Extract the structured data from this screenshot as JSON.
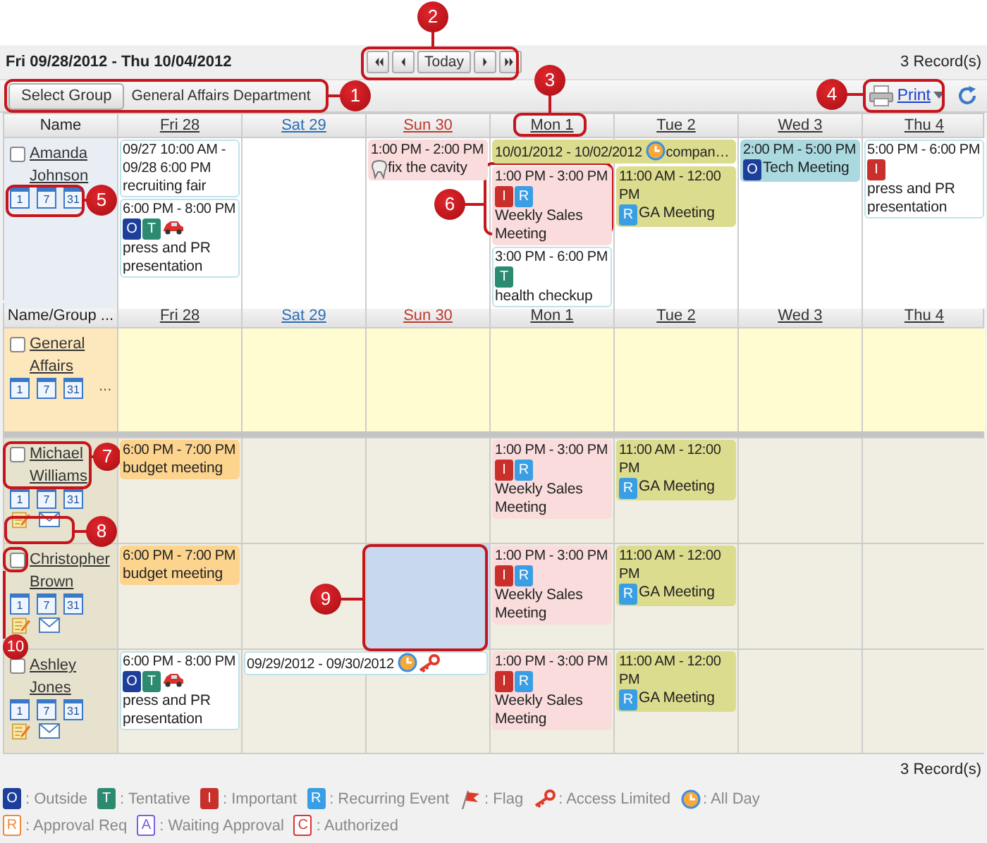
{
  "toolbar": {
    "date_range": "Fri 09/28/2012 - Thu 10/04/2012",
    "nav": [
      {
        "kind": "first"
      },
      {
        "kind": "prev"
      },
      {
        "kind": "today",
        "label": "Today"
      },
      {
        "kind": "next"
      },
      {
        "kind": "last"
      }
    ],
    "record_count": "3 Record(s)"
  },
  "group_bar": {
    "button": "Select Group",
    "group_name": "General Affairs Department",
    "print": "Print"
  },
  "top_section": {
    "header": {
      "name_label": "Name",
      "days": [
        {
          "label": "Fri 28",
          "kind": "weekday"
        },
        {
          "label": "Sat 29",
          "kind": "saturday"
        },
        {
          "label": "Sun 30",
          "kind": "sunday"
        },
        {
          "label": "Mon 1",
          "kind": "weekday"
        },
        {
          "label": "Tue 2",
          "kind": "weekday"
        },
        {
          "label": "Wed 3",
          "kind": "weekday"
        },
        {
          "label": "Thu 4",
          "kind": "weekday"
        }
      ]
    },
    "rows": [
      {
        "kind": "self",
        "name": "Amanda Johnson",
        "checked": false,
        "views": [
          "1",
          "7",
          "31"
        ],
        "tools": false,
        "days": [
          {
            "selected": false,
            "events": [
              {
                "kind": "plain",
                "time": "09/27 10:00 AM - 09/28 6:00 PM",
                "title": "recruiting fair",
                "color": "#ffffff"
              },
              {
                "kind": "vehicle",
                "time": "6:00 PM - 8:00 PM",
                "badges": [
                  {
                    "kind": "outside",
                    "letter": "O"
                  },
                  {
                    "kind": "tentative",
                    "letter": "T"
                  }
                ],
                "title": "press and PR presentation",
                "color": "#ffffff"
              }
            ]
          },
          {
            "selected": false
          },
          {
            "selected": false,
            "events": [
              {
                "kind": "dental",
                "time": "1:00 PM - 2:00 PM",
                "title": "fix the cavity",
                "color": "#fadcdc"
              }
            ]
          },
          {
            "selected": false,
            "events": [
              {
                "kind": "plain",
                "time": "10/01/2012 - 10/02/2012",
                "multi_day": true,
                "all_day": true,
                "title": "compan…",
                "color": "#dcdc8e"
              },
              {
                "kind": "plain",
                "time": "1:00 PM - 3:00 PM",
                "badges": [
                  {
                    "kind": "important",
                    "letter": "I"
                  },
                  {
                    "kind": "recurring",
                    "letter": "R"
                  }
                ],
                "title": "Weekly Sales Meeting",
                "color": "#fadcdc"
              },
              {
                "kind": "plain",
                "time": "3:00 PM - 6:00 PM",
                "badges": [
                  {
                    "kind": "tentative",
                    "letter": "T"
                  }
                ],
                "title": "health checkup",
                "color": "#ffffff"
              }
            ]
          },
          {
            "selected": false,
            "events": [
              {
                "kind": "plain",
                "time": "11:00 AM - 12:00 PM",
                "badges": [
                  {
                    "kind": "recurring",
                    "letter": "R"
                  }
                ],
                "title": "GA Meeting",
                "color": "#dcdc8e"
              }
            ]
          },
          {
            "selected": false,
            "events": [
              {
                "kind": "plain",
                "time": "2:00 PM - 5:00 PM",
                "badges": [
                  {
                    "kind": "outside",
                    "letter": "O"
                  }
                ],
                "title": "Tech Meeting",
                "color": "#aad9e0"
              }
            ]
          },
          {
            "selected": false,
            "events": [
              {
                "kind": "plain",
                "time": "5:00 PM - 6:00 PM",
                "badges": [
                  {
                    "kind": "important",
                    "letter": "I"
                  }
                ],
                "title": "press and PR presentation",
                "color": "#ffffff"
              }
            ]
          }
        ]
      }
    ]
  },
  "group_section": {
    "header": {
      "name_label": "Name/Group ...",
      "days": [
        {
          "label": "Fri 28",
          "kind": "weekday"
        },
        {
          "label": "Sat 29",
          "kind": "saturday"
        },
        {
          "label": "Sun 30",
          "kind": "sunday"
        },
        {
          "label": "Mon 1",
          "kind": "weekday"
        },
        {
          "label": "Tue 2",
          "kind": "weekday"
        },
        {
          "label": "Wed 3",
          "kind": "weekday"
        },
        {
          "label": "Thu 4",
          "kind": "weekday"
        }
      ]
    },
    "rows": [
      {
        "kind": "group",
        "name": "General Affairs",
        "checked": false,
        "views": [
          "1",
          "7",
          "31"
        ],
        "more": "...",
        "tools": false,
        "days": [
          {
            "selected": false
          },
          {
            "selected": false
          },
          {
            "selected": false
          },
          {
            "selected": false
          },
          {
            "selected": false
          },
          {
            "selected": false
          },
          {
            "selected": false
          }
        ]
      },
      {
        "kind": "member",
        "name": "Michael Williams",
        "checked": false,
        "views": [
          "1",
          "7",
          "31"
        ],
        "tools": true,
        "days": [
          {
            "selected": false,
            "events": [
              {
                "kind": "plain",
                "time": "6:00 PM - 7:00 PM",
                "title": "budget meeting",
                "color": "#fcd48e"
              }
            ]
          },
          {
            "selected": false
          },
          {
            "selected": false
          },
          {
            "selected": false,
            "events": [
              {
                "kind": "plain",
                "time": "1:00 PM - 3:00 PM",
                "badges": [
                  {
                    "kind": "important",
                    "letter": "I"
                  },
                  {
                    "kind": "recurring",
                    "letter": "R"
                  }
                ],
                "title": "Weekly Sales Meeting",
                "color": "#fadcdc"
              }
            ]
          },
          {
            "selected": false,
            "events": [
              {
                "kind": "plain",
                "time": "11:00 AM - 12:00 PM",
                "badges": [
                  {
                    "kind": "recurring",
                    "letter": "R"
                  }
                ],
                "title": "GA Meeting",
                "color": "#dcdc8e"
              }
            ]
          },
          {
            "selected": false
          },
          {
            "selected": false
          }
        ]
      },
      {
        "kind": "member",
        "name": "Christopher Brown",
        "checked": false,
        "views": [
          "1",
          "7",
          "31"
        ],
        "tools": true,
        "days": [
          {
            "selected": false,
            "events": [
              {
                "kind": "plain",
                "time": "6:00 PM - 7:00 PM",
                "title": "budget meeting",
                "color": "#fcd48e"
              }
            ]
          },
          {
            "selected": false
          },
          {
            "selected": true
          },
          {
            "selected": false,
            "events": [
              {
                "kind": "plain",
                "time": "1:00 PM - 3:00 PM",
                "badges": [
                  {
                    "kind": "important",
                    "letter": "I"
                  },
                  {
                    "kind": "recurring",
                    "letter": "R"
                  }
                ],
                "title": "Weekly Sales Meeting",
                "color": "#fadcdc"
              }
            ]
          },
          {
            "selected": false,
            "events": [
              {
                "kind": "plain",
                "time": "11:00 AM - 12:00 PM",
                "badges": [
                  {
                    "kind": "recurring",
                    "letter": "R"
                  }
                ],
                "title": "GA Meeting",
                "color": "#dcdc8e"
              }
            ]
          },
          {
            "selected": false
          },
          {
            "selected": false
          }
        ]
      },
      {
        "kind": "member",
        "name": "Ashley Jones",
        "checked": false,
        "views": [
          "1",
          "7",
          "31"
        ],
        "tools": true,
        "days": [
          {
            "selected": false,
            "events": [
              {
                "kind": "vehicle",
                "time": "6:00 PM - 8:00 PM",
                "badges": [
                  {
                    "kind": "outside",
                    "letter": "O"
                  },
                  {
                    "kind": "tentative",
                    "letter": "T"
                  }
                ],
                "title": "press and PR presentation",
                "color": "#ffffff"
              }
            ]
          },
          {
            "selected": false,
            "events": [
              {
                "kind": "plain",
                "time": "09/29/2012 - 09/30/2012",
                "multi_day": true,
                "all_day": true,
                "access_limited": true,
                "color": "#ffffff"
              }
            ]
          },
          {
            "selected": false
          },
          {
            "selected": false,
            "events": [
              {
                "kind": "plain",
                "time": "1:00 PM - 3:00 PM",
                "badges": [
                  {
                    "kind": "important",
                    "letter": "I"
                  },
                  {
                    "kind": "recurring",
                    "letter": "R"
                  }
                ],
                "title": "Weekly Sales Meeting",
                "color": "#fadcdc"
              }
            ]
          },
          {
            "selected": false,
            "events": [
              {
                "kind": "plain",
                "time": "11:00 AM - 12:00 PM",
                "badges": [
                  {
                    "kind": "recurring",
                    "letter": "R"
                  }
                ],
                "title": "GA Meeting",
                "color": "#dcdc8e"
              }
            ]
          },
          {
            "selected": false
          },
          {
            "selected": false
          }
        ]
      }
    ]
  },
  "footer": {
    "record_count": "3 Record(s)"
  },
  "legend": {
    "items": [
      {
        "kind": "outside",
        "letter": "O",
        "label": ": Outside"
      },
      {
        "kind": "tentative",
        "letter": "T",
        "label": ": Tentative"
      },
      {
        "kind": "important",
        "letter": "I",
        "label": ": Important"
      },
      {
        "kind": "recurring",
        "letter": "R",
        "label": ": Recurring Event"
      },
      {
        "kind": "flag",
        "label": ": Flag"
      },
      {
        "kind": "access_limited",
        "label": ": Access Limited"
      },
      {
        "kind": "all_day",
        "label": ": All Day"
      },
      {
        "kind": "approval_req",
        "letter": "R",
        "label": ": Approval Req"
      },
      {
        "kind": "waiting",
        "letter": "A",
        "label": ": Waiting Approval"
      },
      {
        "kind": "authorized",
        "letter": "C",
        "label": ": Authorized"
      }
    ]
  },
  "callouts": [
    {
      "number": "1"
    },
    {
      "number": "2"
    },
    {
      "number": "3"
    },
    {
      "number": "4"
    },
    {
      "number": "5"
    },
    {
      "number": "6"
    },
    {
      "number": "7"
    },
    {
      "number": "8"
    },
    {
      "number": "9"
    },
    {
      "number": "10"
    }
  ]
}
